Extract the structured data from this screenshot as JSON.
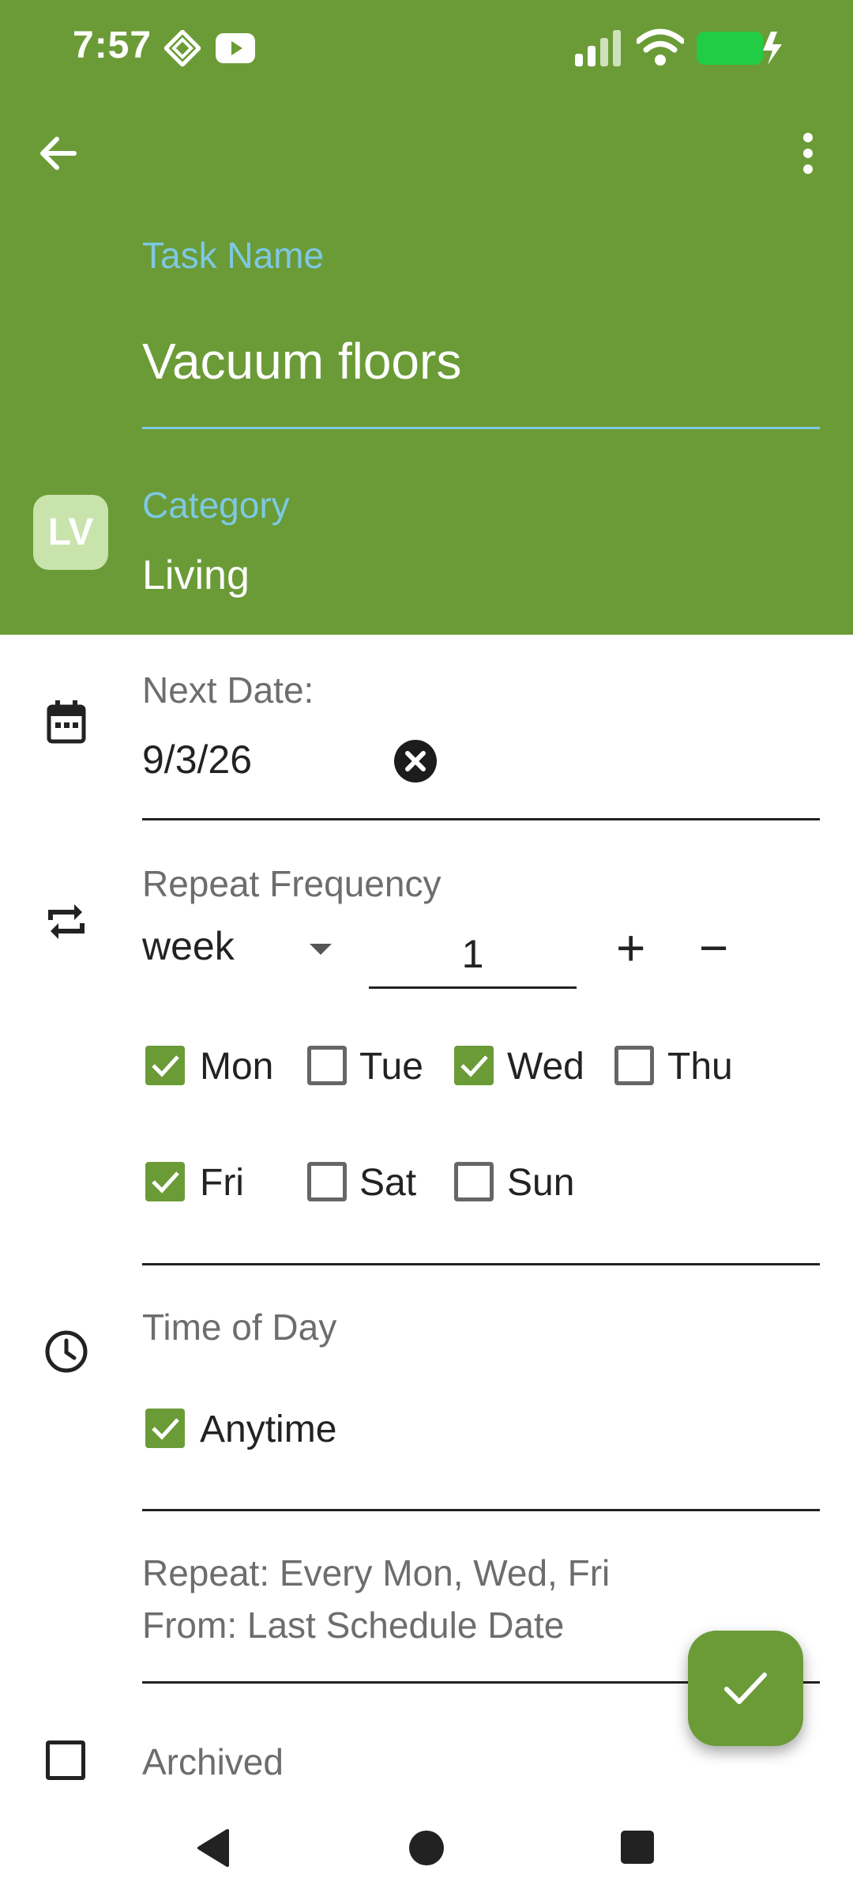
{
  "status_bar": {
    "time": "7:57",
    "icons": [
      "kodi-icon",
      "youtube-icon",
      "signal-icon",
      "wifi-icon",
      "battery-charging-icon"
    ],
    "battery_color": "#22cc44"
  },
  "theme": {
    "accent": "#6b9b37",
    "label_blue": "#7ec8e3"
  },
  "toolbar": {
    "back_icon": "arrow-left-icon",
    "menu_icon": "more-vertical-icon"
  },
  "task": {
    "name_label": "Task Name",
    "name_value": "Vacuum floors"
  },
  "category": {
    "badge": "LV",
    "label": "Category",
    "value": "Living"
  },
  "next_date": {
    "label": "Next Date:",
    "value": "9/3/26"
  },
  "repeat": {
    "label": "Repeat Frequency",
    "unit": "week",
    "count": "1",
    "plus": "+",
    "minus": "−",
    "days": [
      {
        "label": "Mon",
        "checked": true
      },
      {
        "label": "Tue",
        "checked": false
      },
      {
        "label": "Wed",
        "checked": true
      },
      {
        "label": "Thu",
        "checked": false
      },
      {
        "label": "Fri",
        "checked": true
      },
      {
        "label": "Sat",
        "checked": false
      },
      {
        "label": "Sun",
        "checked": false
      }
    ]
  },
  "time_of_day": {
    "label": "Time of Day",
    "option": "Anytime",
    "checked": true
  },
  "summary": {
    "line1": "Repeat: Every Mon, Wed, Fri",
    "line2": "From: Last Schedule Date"
  },
  "archived": {
    "label": "Archived",
    "checked": false
  },
  "nav": {
    "back": "back-triangle-icon",
    "home": "home-circle-icon",
    "recents": "recents-square-icon"
  }
}
